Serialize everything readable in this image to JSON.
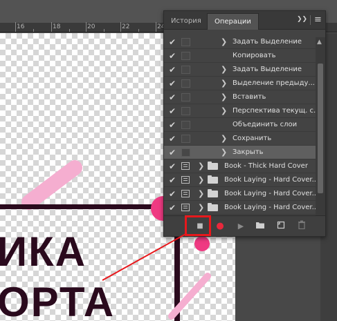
{
  "ruler": {
    "marks": [
      "16",
      "18",
      "20",
      "22",
      "24"
    ]
  },
  "artwork": {
    "line1": "ИКА",
    "line2": "ОРТА"
  },
  "panel": {
    "tabs": [
      {
        "label": "История",
        "active": false
      },
      {
        "label": "Операции",
        "active": true
      }
    ],
    "controls": {
      "collapse": "❯❯",
      "menu": "≡"
    },
    "rows": [
      {
        "kind": "step",
        "checked": true,
        "expander": "❯",
        "label": "Задать Выделение"
      },
      {
        "kind": "step",
        "checked": true,
        "expander": "",
        "label": "Копировать"
      },
      {
        "kind": "step",
        "checked": true,
        "expander": "❯",
        "label": "Задать Выделение"
      },
      {
        "kind": "step",
        "checked": true,
        "expander": "❯",
        "label": "Выделение  предыду..."
      },
      {
        "kind": "step",
        "checked": true,
        "expander": "❯",
        "label": "Вставить"
      },
      {
        "kind": "step",
        "checked": true,
        "expander": "❯",
        "label": "Перспектива текущ. с..."
      },
      {
        "kind": "step",
        "checked": true,
        "expander": "",
        "label": "Объединить слои"
      },
      {
        "kind": "step",
        "checked": true,
        "expander": "❯",
        "label": "Сохранить"
      },
      {
        "kind": "step",
        "checked": true,
        "expander": "❯",
        "label": "Закрыть",
        "highlighted": true
      },
      {
        "kind": "set",
        "checked": true,
        "expander": "❯",
        "label": "Book - Thick Hard Cover"
      },
      {
        "kind": "set",
        "checked": true,
        "expander": "❯",
        "label": "Book Laying - Hard Cover..."
      },
      {
        "kind": "set",
        "checked": true,
        "expander": "❯",
        "label": "Book Laying - Hard Cover..."
      },
      {
        "kind": "set",
        "checked": true,
        "expander": "❯",
        "label": "Book Laying - Hard Cover..."
      }
    ],
    "toolbar": {
      "stop": "■",
      "record": "●",
      "play": "▶",
      "new_set": "folder",
      "new_action": "new",
      "delete": "trash"
    }
  },
  "colors": {
    "accent_red": "#e8181c",
    "record_red": "#e8283c",
    "art_pink": "#f5aed0",
    "art_magenta": "#ef3a82",
    "art_dark": "#2a0a1d"
  }
}
